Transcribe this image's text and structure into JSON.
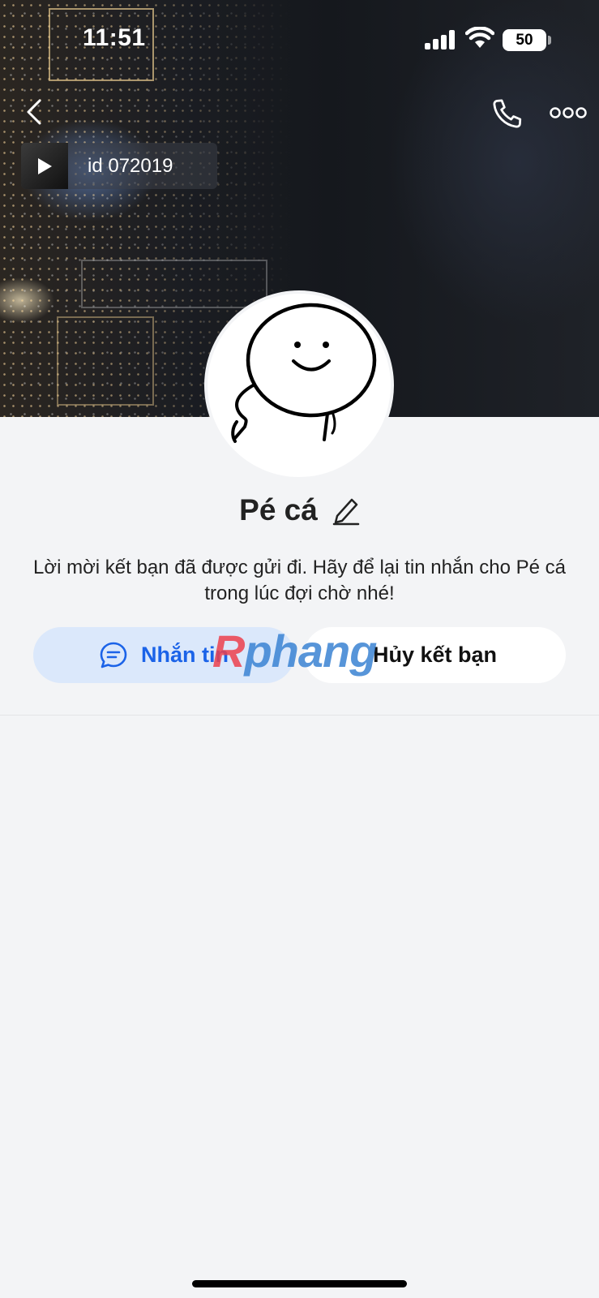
{
  "status_bar": {
    "time": "11:51",
    "battery": "50",
    "signal_icon": "cellular-signal-icon",
    "wifi_icon": "wifi-icon"
  },
  "header": {
    "back_icon": "chevron-left-icon",
    "call_icon": "phone-icon",
    "more_icon": "more-horizontal-icon"
  },
  "music": {
    "label": "id 072019",
    "icon": "play-icon"
  },
  "profile": {
    "name": "Pé cá",
    "edit_icon": "pencil-icon",
    "avatar_icon": "smiley-character-avatar",
    "message": "Lời mời kết bạn đã được gửi đi. Hãy để lại tin nhắn cho Pé cá trong lúc đợi chờ nhé!"
  },
  "actions": {
    "message_label": "Nhắn tin",
    "message_icon": "chat-bubble-icon",
    "unfriend_label": "Hủy kết bạn"
  },
  "watermark": {
    "part1": "R",
    "part2": "phang"
  },
  "colors": {
    "accent": "#1b63e8",
    "message_button_bg": "#dbe8fb",
    "page_bg": "#f3f4f6"
  }
}
